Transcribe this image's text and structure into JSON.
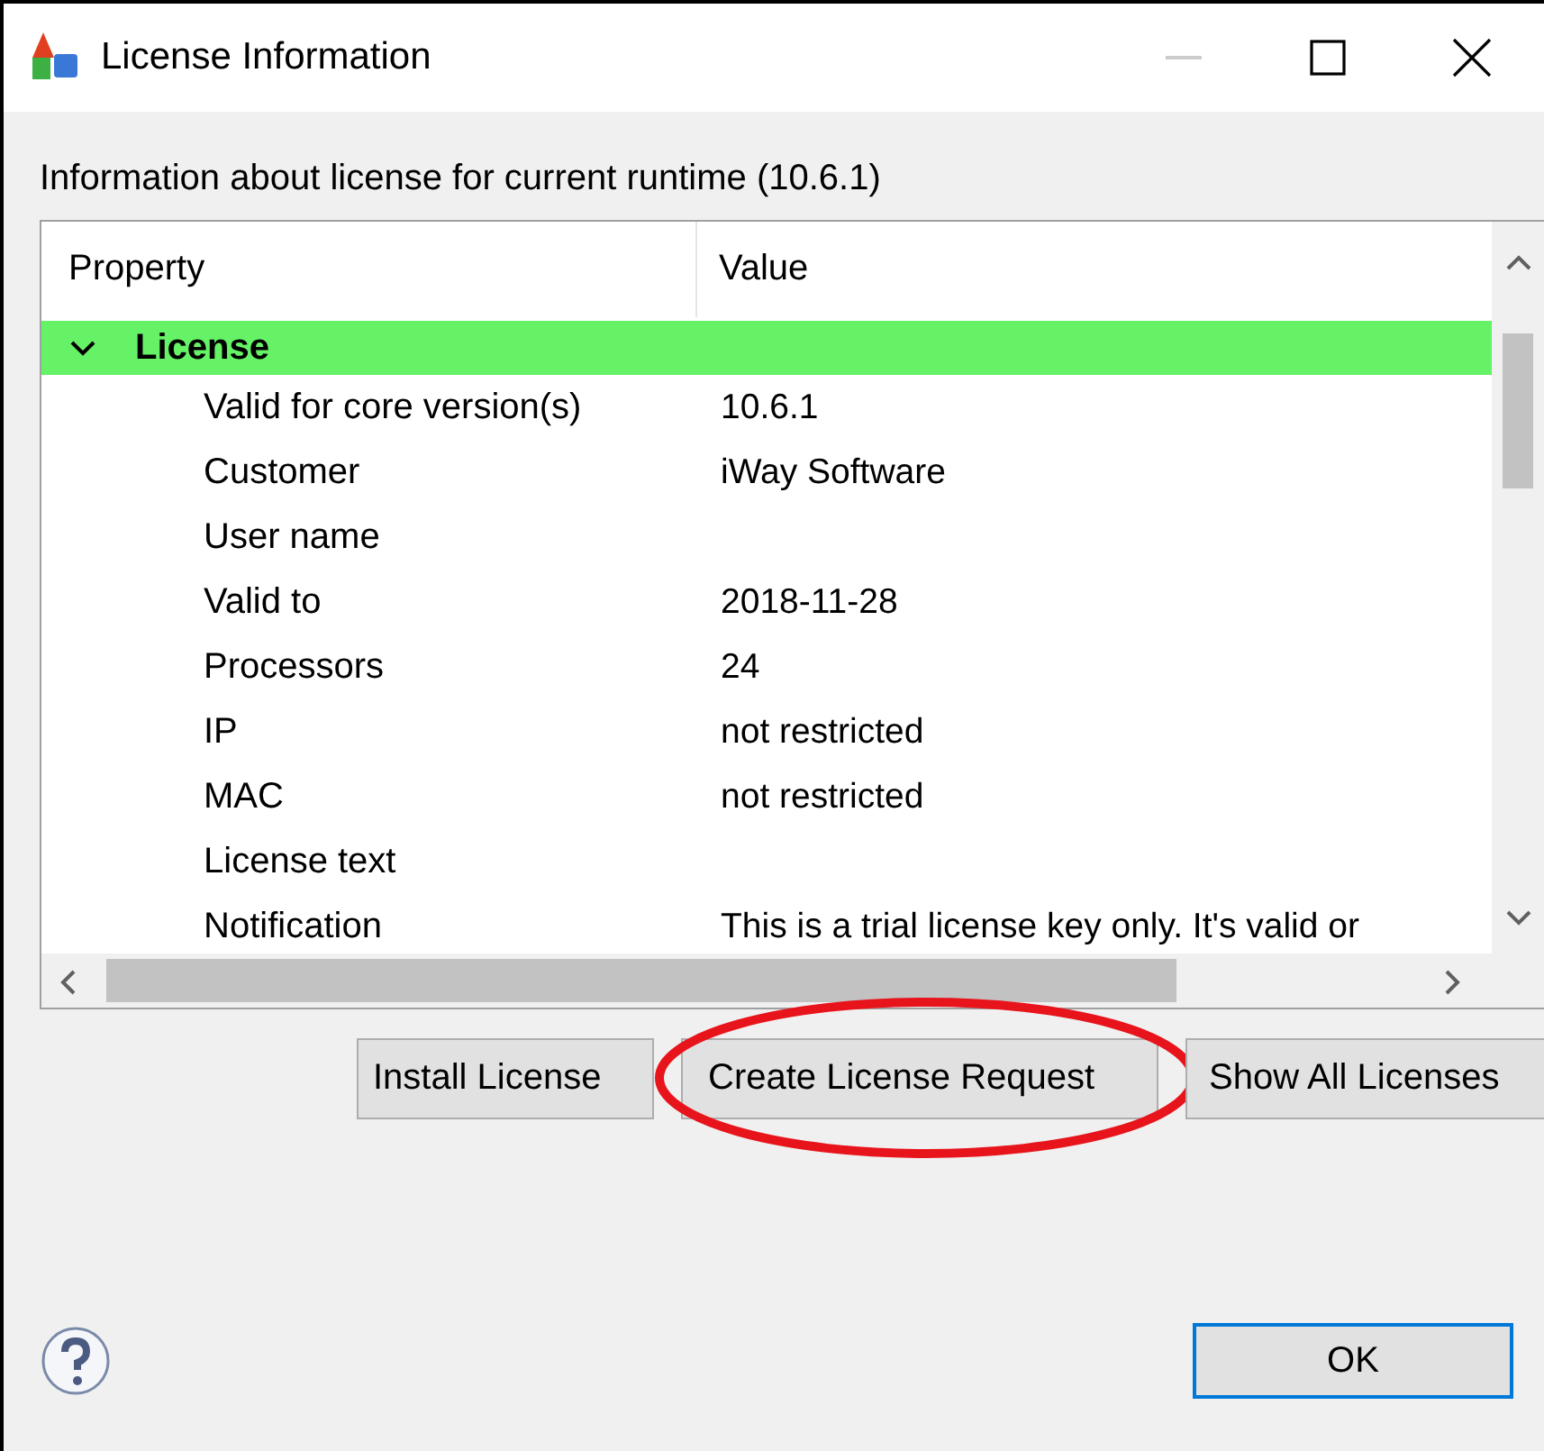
{
  "window": {
    "title": "License Information"
  },
  "description": "Information about license for current runtime (10.6.1)",
  "table": {
    "columns": [
      "Property",
      "Value"
    ],
    "rows": [
      {
        "property": "License",
        "expanded": true,
        "selected": true,
        "children": [
          {
            "property": "Valid for core version(s)",
            "value": "10.6.1"
          },
          {
            "property": "Customer",
            "value": "iWay Software"
          },
          {
            "property": "User name"
          },
          {
            "property": "Valid to",
            "value": "2018-11-28"
          },
          {
            "property": "Processors",
            "value": "24"
          },
          {
            "property": "IP",
            "value": "not restricted"
          },
          {
            "property": "MAC",
            "value": "not restricted"
          },
          {
            "property": "License text"
          },
          {
            "property": "Notification",
            "value": "This is a trial license key only. It's valid or"
          }
        ]
      }
    ]
  },
  "buttons": [
    {
      "label": "Install License",
      "highlighted": false
    },
    {
      "label": "Create License Request",
      "highlighted": true
    },
    {
      "label": "Show All Licenses",
      "highlighted": false
    }
  ],
  "ok_button": "OK"
}
